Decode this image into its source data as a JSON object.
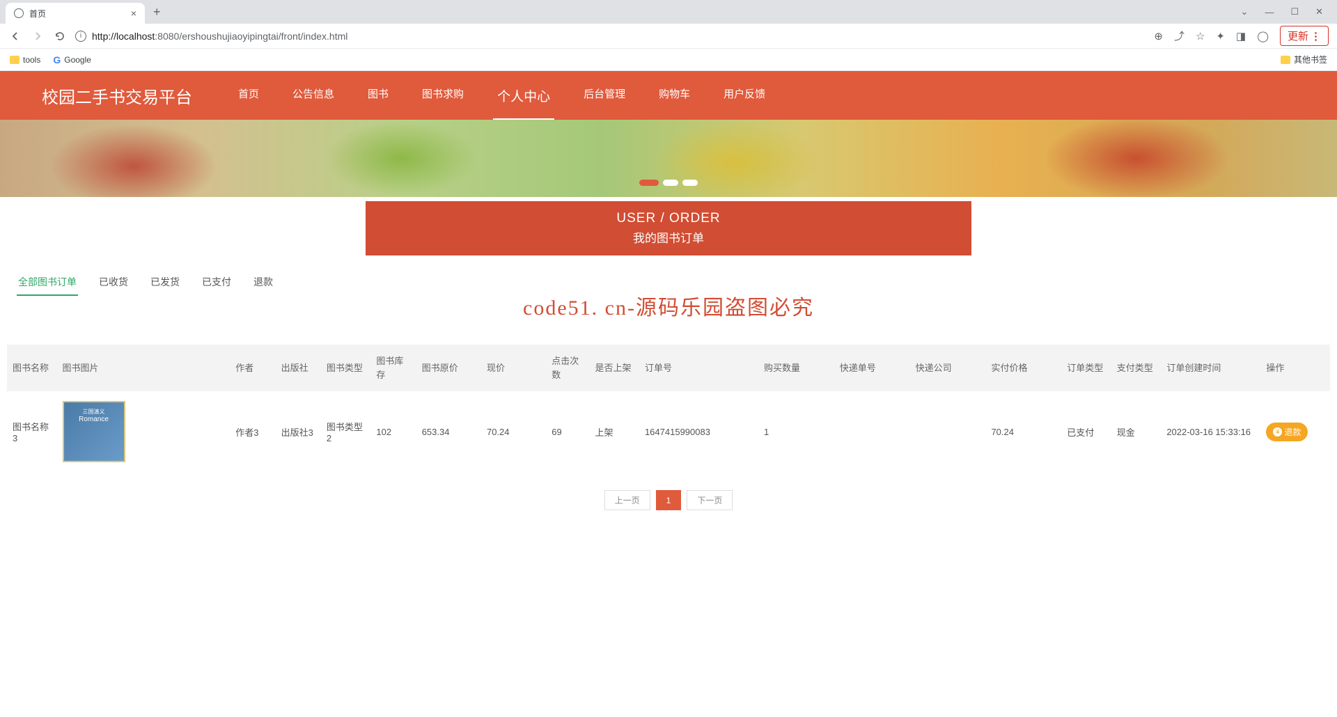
{
  "browser": {
    "tab_title": "首页",
    "url_host": "localhost",
    "url_port": ":8080",
    "url_path": "/ershoushujiaoyipingtai/front/index.html",
    "update_label": "更新",
    "bookmarks": {
      "tools": "tools",
      "google": "Google",
      "other": "其他书签"
    }
  },
  "header": {
    "site_title": "校园二手书交易平台",
    "nav": [
      "首页",
      "公告信息",
      "图书",
      "图书求购",
      "个人中心",
      "后台管理",
      "购物车",
      "用户反馈"
    ]
  },
  "page_title": {
    "en": "USER / ORDER",
    "cn": "我的图书订单"
  },
  "tabs": [
    "全部图书订单",
    "已收货",
    "已发货",
    "已支付",
    "退款"
  ],
  "watermark_center": "code51. cn-源码乐园盗图必究",
  "table": {
    "headers": [
      "图书名称",
      "图书图片",
      "作者",
      "出版社",
      "图书类型",
      "图书库存",
      "图书原价",
      "现价",
      "点击次数",
      "是否上架",
      "订单号",
      "购买数量",
      "快递单号",
      "快递公司",
      "实付价格",
      "订单类型",
      "支付类型",
      "订单创建时间",
      "操作"
    ],
    "row": {
      "name": "图书名称3",
      "author": "作者3",
      "publisher": "出版社3",
      "type": "图书类型2",
      "stock": "102",
      "orig_price": "653.34",
      "now_price": "70.24",
      "clicks": "69",
      "on_shelf": "上架",
      "order_no": "1647415990083",
      "qty": "1",
      "express_no": "",
      "express_co": "",
      "paid": "70.24",
      "order_type": "已支付",
      "pay_type": "现金",
      "created": "2022-03-16 15:33:16",
      "refund_btn": "退款",
      "book_img_t1": "三国演义",
      "book_img_t2": "Romance"
    }
  },
  "pagination": {
    "prev": "上一页",
    "page": "1",
    "next": "下一页"
  }
}
